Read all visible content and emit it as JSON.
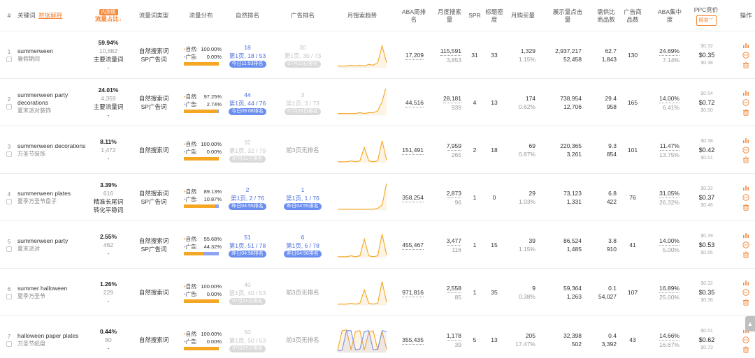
{
  "header": {
    "index": "#",
    "keyword": "关键词",
    "keyword_link": "数据解释",
    "share_badge": "内测版",
    "share": "流量占比↓",
    "type": "流量词类型",
    "dist": "流量分布",
    "natural_rank": "自然排名",
    "ad_rank": "广告排名",
    "trend": "月搜索趋势",
    "aba_rank": "ABA周排名",
    "monthly_search": "月度搜索量",
    "spr": "SPR",
    "title_density": "标题密度",
    "monthly_purchase": "月购买量",
    "impressions": "展示量点击量",
    "supply_ratio": "需供比商品数",
    "ad_products": "广告商品数",
    "aba_conc": "ABA集中度",
    "ppc": "PPC竞价",
    "ppc_select": "精准",
    "ops": "操作"
  },
  "colors": {
    "orange": "#f5a623",
    "blue": "#8ea4f0",
    "accent": "#f58a3c",
    "link": "#4a6cd8"
  },
  "rows": [
    {
      "idx": "1",
      "kw": "summerween",
      "kw_cn": "暑假期间",
      "share_pct": "59.94%",
      "share_num": "10,882",
      "share_tag": "主要流量词",
      "share_tag2": "-",
      "type1": "自然搜索词",
      "type2": "SP广告词",
      "nat_label": "自然:",
      "nat_pct": "100.00%",
      "ad_label": "广告:",
      "ad_pct": "0.00%",
      "ad_frac": 0,
      "nr_num": "18",
      "nr_detail": "第1页, 18 / 53",
      "nr_pill": "今日11:53排名",
      "nr_pill_type": "blue",
      "nr_style": "blue",
      "ar_num": "30",
      "ar_detail": "第1页, 30 / 73",
      "ar_pill": "07月13日排名",
      "ar_pill_type": "gray",
      "ar_style": "muted",
      "trend": [
        2,
        2,
        2,
        3,
        2,
        3,
        2,
        4,
        3,
        6,
        26,
        6
      ],
      "trend2": null,
      "aba": "17,209",
      "ms1": "115,591",
      "ms2": "3,853",
      "spr": "31",
      "td": "33",
      "mp1": "1,329",
      "mp2": "1.15%",
      "imp1": "2,937,217",
      "imp2": "52,458",
      "sr1": "62.7",
      "sr2": "1,843",
      "adp": "130",
      "conc1": "24.69%",
      "conc2": "7.14%",
      "ppc_hi": "$0.32",
      "ppc_mid": "$0.35",
      "ppc_lo": "$0.38"
    },
    {
      "idx": "2",
      "kw": "summerween party decorations",
      "kw_cn": "夏末派对装饰",
      "share_pct": "24.01%",
      "share_num": "4,359",
      "share_tag": "主要流量词",
      "share_tag2": "-",
      "type1": "自然搜索词",
      "type2": "SP广告词",
      "nat_label": "自然:",
      "nat_pct": "97.25%",
      "ad_label": "广告:",
      "ad_pct": "2.74%",
      "ad_frac": 0.0274,
      "nr_num": "44",
      "nr_detail": "第1页, 44 / 76",
      "nr_pill": "今日09:08排名",
      "nr_pill_type": "blue",
      "nr_style": "blue",
      "ar_num": "3",
      "ar_detail": "第1页, 3 / 73",
      "ar_pill": "07月28日排名",
      "ar_pill_type": "gray",
      "ar_style": "muted",
      "trend": [
        2,
        2,
        2,
        2,
        2,
        3,
        2,
        3,
        3,
        5,
        16,
        36
      ],
      "trend2": null,
      "aba": "44,516",
      "ms1": "28,181",
      "ms2": "939",
      "spr": "4",
      "td": "13",
      "mp1": "174",
      "mp2": "0.62%",
      "imp1": "738,954",
      "imp2": "12,706",
      "sr1": "29.4",
      "sr2": "958",
      "adp": "165",
      "conc1": "14.00%",
      "conc2": "6.41%",
      "ppc_hi": "$0.54",
      "ppc_mid": "$0.72",
      "ppc_lo": "$0.90"
    },
    {
      "idx": "3",
      "kw": "summerween decorations",
      "kw_cn": "万圣节装饰",
      "share_pct": "8.11%",
      "share_num": "1,472",
      "share_tag": "-",
      "share_tag2": "",
      "type1": "自然搜索词",
      "type2": "",
      "nat_label": "自然:",
      "nat_pct": "100.00%",
      "ad_label": "广告:",
      "ad_pct": "0.00%",
      "ad_frac": 0,
      "nr_num": "32",
      "nr_detail": "第1页, 32 / 79",
      "nr_pill": "07月31日排名",
      "nr_pill_type": "gray",
      "nr_style": "muted",
      "ar_num": "",
      "ar_detail": "前3页无排名",
      "ar_pill": "",
      "ar_pill_type": "",
      "ar_style": "gray",
      "trend": [
        1,
        1,
        1,
        2,
        1,
        2,
        18,
        2,
        1,
        2,
        26,
        3
      ],
      "trend2": null,
      "aba": "151,491",
      "ms1": "7,959",
      "ms2": "265",
      "spr": "2",
      "td": "18",
      "mp1": "69",
      "mp2": "0.87%",
      "imp1": "220,365",
      "imp2": "3,261",
      "sr1": "9.3",
      "sr2": "854",
      "adp": "101",
      "conc1": "11.47%",
      "conc2": "13.75%",
      "ppc_hi": "$0.38",
      "ppc_mid": "$0.42",
      "ppc_lo": "$0.51"
    },
    {
      "idx": "4",
      "kw": "summerween plates",
      "kw_cn": "夏季万圣节盘子",
      "share_pct": "3.39%",
      "share_num": "616",
      "share_tag": "精准长尾词",
      "share_tag2": "转化平稳词",
      "type1": "自然搜索词",
      "type2": "SP广告词",
      "nat_label": "自然:",
      "nat_pct": "89.13%",
      "ad_label": "广告:",
      "ad_pct": "10.87%",
      "ad_frac": 0.1087,
      "nr_num": "2",
      "nr_detail": "第1页, 2 / 76",
      "nr_pill": "昨日04:55排名",
      "nr_pill_type": "blue",
      "nr_style": "blue",
      "ar_num": "1",
      "ar_detail": "第1页, 1 / 76",
      "ar_pill": "昨日04:55排名",
      "ar_pill_type": "blue",
      "ar_style": "blue",
      "trend": [
        1,
        1,
        1,
        1,
        1,
        1,
        1,
        1,
        1,
        2,
        6,
        32
      ],
      "trend2": null,
      "aba": "358,254",
      "ms1": "2,873",
      "ms2": "96",
      "spr": "1",
      "td": "0",
      "mp1": "29",
      "mp2": "1.03%",
      "imp1": "73,123",
      "imp2": "1,331",
      "sr1": "6.8",
      "sr2": "422",
      "adp": "76",
      "conc1": "31.05%",
      "conc2": "26.32%",
      "ppc_hi": "$0.32",
      "ppc_mid": "$0.37",
      "ppc_lo": "$0.46"
    },
    {
      "idx": "5",
      "kw": "summerween party",
      "kw_cn": "夏末派对",
      "share_pct": "2.55%",
      "share_num": "462",
      "share_tag": "-",
      "share_tag2": "",
      "type1": "自然搜索词",
      "type2": "SP广告词",
      "nat_label": "自然:",
      "nat_pct": "55.68%",
      "ad_label": "广告:",
      "ad_pct": "44.32%",
      "ad_frac": 0.4432,
      "nr_num": "51",
      "nr_detail": "第1页, 51 / 78",
      "nr_pill": "昨日04:56排名",
      "nr_pill_type": "blue",
      "nr_style": "blue",
      "ar_num": "6",
      "ar_detail": "第1页, 6 / 78",
      "ar_pill": "昨日04:56排名",
      "ar_pill_type": "blue",
      "ar_style": "blue",
      "trend": [
        1,
        1,
        1,
        2,
        1,
        2,
        22,
        2,
        1,
        2,
        28,
        3
      ],
      "trend2": null,
      "aba": "455,467",
      "ms1": "3,477",
      "ms2": "116",
      "spr": "1",
      "td": "15",
      "mp1": "39",
      "mp2": "1.15%",
      "imp1": "86,524",
      "imp2": "1,485",
      "sr1": "3.8",
      "sr2": "910",
      "adp": "41",
      "conc1": "14.00%",
      "conc2": "5.00%",
      "ppc_hi": "$0.39",
      "ppc_mid": "$0.53",
      "ppc_lo": "$0.66"
    },
    {
      "idx": "6",
      "kw": "summer halloween",
      "kw_cn": "夏季万圣节",
      "share_pct": "1.26%",
      "share_num": "229",
      "share_tag": "-",
      "share_tag2": "",
      "type1": "自然搜索词",
      "type2": "",
      "nat_label": "自然:",
      "nat_pct": "100.00%",
      "ad_label": "广告:",
      "ad_pct": "0.00%",
      "ad_frac": 0,
      "nr_num": "40",
      "nr_detail": "第1页, 40 / 53",
      "nr_pill": "07月31日排名",
      "nr_pill_type": "gray",
      "nr_style": "muted",
      "ar_num": "",
      "ar_detail": "前3页无排名",
      "ar_pill": "",
      "ar_pill_type": "",
      "ar_style": "gray",
      "trend": [
        1,
        1,
        1,
        2,
        1,
        2,
        18,
        2,
        1,
        2,
        28,
        3
      ],
      "trend2": null,
      "aba": "971,816",
      "ms1": "2,558",
      "ms2": "85",
      "spr": "1",
      "td": "35",
      "mp1": "9",
      "mp2": "0.38%",
      "imp1": "59,364",
      "imp2": "1,263",
      "sr1": "0.1",
      "sr2": "54,027",
      "adp": "107",
      "conc1": "16.89%",
      "conc2": "25.00%",
      "ppc_hi": "$0.32",
      "ppc_mid": "$0.35",
      "ppc_lo": "$0.38"
    },
    {
      "idx": "7",
      "kw": "halloween paper plates",
      "kw_cn": "万圣节纸盘",
      "share_pct": "0.44%",
      "share_num": "80",
      "share_tag": "-",
      "share_tag2": "",
      "type1": "自然搜索词",
      "type2": "",
      "nat_label": "自然:",
      "nat_pct": "100.00%",
      "ad_label": "广告:",
      "ad_pct": "0.00%",
      "ad_frac": 0,
      "nr_num": "50",
      "nr_detail": "第1页, 50 / 53",
      "nr_pill": "07月29日排名",
      "nr_pill_type": "gray",
      "nr_style": "muted",
      "ar_num": "",
      "ar_detail": "前3页无排名",
      "ar_pill": "",
      "ar_pill_type": "",
      "ar_style": "gray",
      "trend": [
        3,
        26,
        27,
        3,
        25,
        26,
        3,
        24,
        26,
        3,
        25,
        4
      ],
      "trend2": [
        2,
        3,
        26,
        26,
        3,
        4,
        25,
        26,
        3,
        4,
        26,
        25
      ],
      "aba": "355,435",
      "ms1": "1,178",
      "ms2": "39",
      "spr": "5",
      "td": "13",
      "mp1": "205",
      "mp2": "17.47%",
      "imp1": "32,398",
      "imp2": "502",
      "sr1": "0.4",
      "sr2": "3,392",
      "adp": "43",
      "conc1": "14.66%",
      "conc2": "16.67%",
      "ppc_hi": "$0.51",
      "ppc_mid": "$0.62",
      "ppc_lo": "$0.73"
    }
  ]
}
